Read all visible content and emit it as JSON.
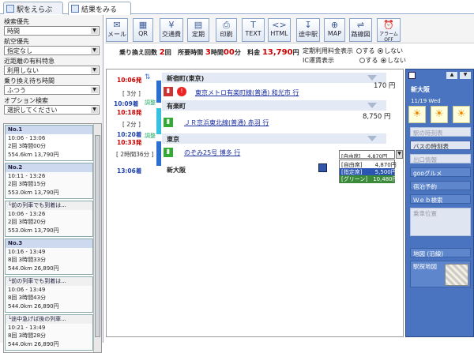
{
  "tabs": {
    "search": "駅をえらぶ",
    "results": "結果をみる"
  },
  "left": {
    "priority_label": "検索優先",
    "priority_value": "時間",
    "airline_label": "航空優先",
    "airline_value": "指定なし",
    "express_label": "近距離の有料特急",
    "express_value": "利用しない",
    "wait_label": "乗り換え待ち時間",
    "wait_value": "ふつう",
    "option_label": "オプション検索",
    "option_value": "選択してください",
    "routes": [
      {
        "header": "No.1",
        "time": "10:06 - 13:06",
        "transfer": "2回 3時間00分",
        "dist": "554.6km 13,790円"
      },
      {
        "header": "No.2",
        "time": "10:11 - 13:26",
        "transfer": "2回 3時間15分",
        "dist": "553.0km 13,790円"
      },
      {
        "header": "└前の列車でも到着は...",
        "time": "10:06 - 13:26",
        "transfer": "2回 3時間20分",
        "dist": "553.0km 13,790円"
      },
      {
        "header": "No.3",
        "time": "10:16 - 13:49",
        "transfer": "8回 3時間33分",
        "dist": "544.0km 26,890円"
      },
      {
        "header": "└前の列車でも到着は...",
        "time": "10:06 - 13:49",
        "transfer": "8回 3時間43分",
        "dist": "544.0km 26,890円"
      },
      {
        "header": "└途中急げば後の列車...",
        "time": "10:21 - 13:49",
        "transfer": "8回 3時間28分",
        "dist": "544.0km 26,890円"
      }
    ]
  },
  "toolbar": [
    "メール",
    "QR",
    "交通費",
    "定期",
    "印刷",
    "TEXT",
    "HTML",
    "途中駅",
    "MAP",
    "路線図",
    "アラームOFF"
  ],
  "toolbar_glyphs": [
    "✉",
    "▦",
    "¥",
    "▤",
    "⎙",
    "T",
    "<>",
    "↧",
    "⊕",
    "⇌",
    "⏰"
  ],
  "info": {
    "transfer_label": "乗り換え回数",
    "transfer_value": "2",
    "transfer_unit": "回",
    "time_label": "所要時間",
    "time_h": "3",
    "time_hu": "時間",
    "time_m": "00",
    "time_mu": "分",
    "fare_label": "料金",
    "fare_value": "13,790",
    "fare_unit": "円",
    "commuter_label": "定期利用料金表示",
    "ic_label": "IC運賃表示",
    "opt_yes": "する",
    "opt_no": "しない"
  },
  "route": {
    "stations": [
      "新宿町(東京)",
      "有楽町",
      "東京",
      "新大阪"
    ],
    "times": {
      "t1": "10:06発",
      "t2a": "10:09着",
      "t2b": "10:18発",
      "t3a": "10:20着",
      "t3b": "10:33発",
      "t4": "13:06着"
    },
    "durations": [
      "[ 3分 ]",
      "[ 2分 ]",
      "[ 2時間36分 ]"
    ],
    "lines": [
      "東京メトロ有楽町線(普通) 和光市 行",
      "ＪＲ京浜東北線(普通) 赤羽 行",
      "のぞみ25号 博多 行"
    ],
    "fares": [
      "170 円",
      "8,750 円"
    ],
    "adjust": "調整",
    "seat_select": "[自由席]　 4,870円",
    "seat_options": [
      "[自由席]　　 4,870円",
      "[指定席]　　 5,500円",
      "[グリーン]　10,480円"
    ]
  },
  "right": {
    "station": "新大阪",
    "date": "11/19 Wed",
    "buttons": [
      "駅の時刻表",
      "バスの時刻表",
      "出口情報",
      "gooグルメ",
      "宿泊予約",
      "Ｗｅｂ検索",
      "乗車位置",
      "地図 (沿線)",
      "駅探地図"
    ]
  },
  "colors": {
    "accent": "#4a73c0",
    "red": "#cc0000"
  }
}
